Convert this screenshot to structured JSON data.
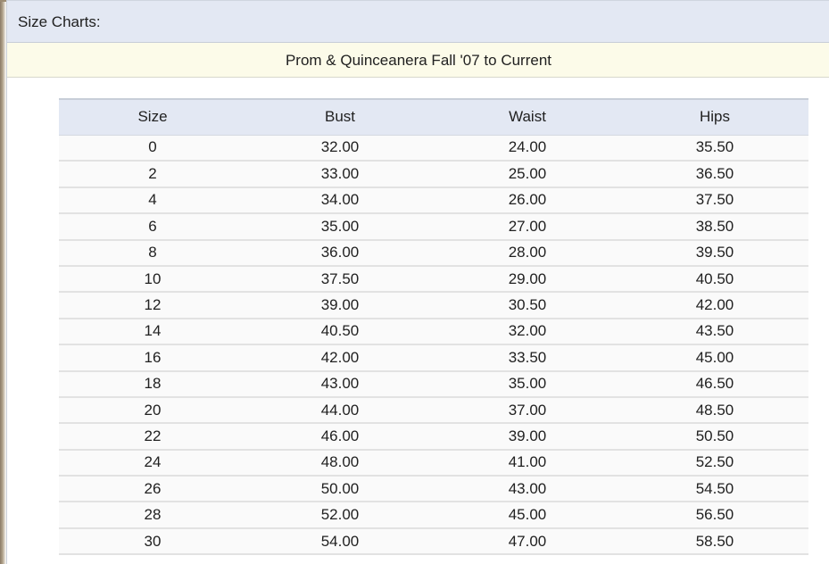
{
  "panel": {
    "title": "Size Charts:"
  },
  "chart": {
    "title": "Prom & Quinceanera Fall '07 to Current",
    "headers": [
      "Size",
      "Bust",
      "Waist",
      "Hips"
    ],
    "rows": [
      [
        "0",
        "32.00",
        "24.00",
        "35.50"
      ],
      [
        "2",
        "33.00",
        "25.00",
        "36.50"
      ],
      [
        "4",
        "34.00",
        "26.00",
        "37.50"
      ],
      [
        "6",
        "35.00",
        "27.00",
        "38.50"
      ],
      [
        "8",
        "36.00",
        "28.00",
        "39.50"
      ],
      [
        "10",
        "37.50",
        "29.00",
        "40.50"
      ],
      [
        "12",
        "39.00",
        "30.50",
        "42.00"
      ],
      [
        "14",
        "40.50",
        "32.00",
        "43.50"
      ],
      [
        "16",
        "42.00",
        "33.50",
        "45.00"
      ],
      [
        "18",
        "43.00",
        "35.00",
        "46.50"
      ],
      [
        "20",
        "44.00",
        "37.00",
        "48.50"
      ],
      [
        "22",
        "46.00",
        "39.00",
        "50.50"
      ],
      [
        "24",
        "48.00",
        "41.00",
        "52.50"
      ],
      [
        "26",
        "50.00",
        "43.00",
        "54.50"
      ],
      [
        "28",
        "52.00",
        "45.00",
        "56.50"
      ],
      [
        "30",
        "54.00",
        "47.00",
        "58.50"
      ]
    ]
  }
}
